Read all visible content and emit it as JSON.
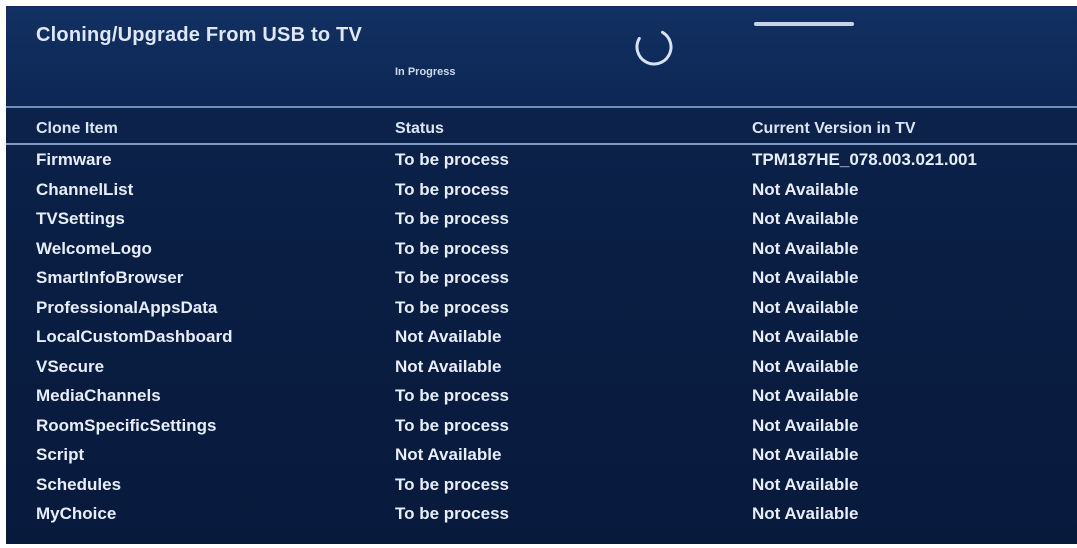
{
  "header": {
    "title": "Cloning/Upgrade From USB to TV",
    "status_text": "In Progress"
  },
  "columns": {
    "item": "Clone Item",
    "status": "Status",
    "version": "Current Version in TV"
  },
  "rows": [
    {
      "item": "Firmware",
      "status": "To be process",
      "version": "TPM187HE_078.003.021.001"
    },
    {
      "item": "ChannelList",
      "status": "To be process",
      "version": "Not Available"
    },
    {
      "item": "TVSettings",
      "status": "To be process",
      "version": "Not Available"
    },
    {
      "item": "WelcomeLogo",
      "status": "To be process",
      "version": "Not Available"
    },
    {
      "item": "SmartInfoBrowser",
      "status": "To be process",
      "version": "Not Available"
    },
    {
      "item": "ProfessionalAppsData",
      "status": "To be process",
      "version": "Not Available"
    },
    {
      "item": "LocalCustomDashboard",
      "status": "Not Available",
      "version": "Not Available"
    },
    {
      "item": "VSecure",
      "status": "Not Available",
      "version": "Not Available"
    },
    {
      "item": "MediaChannels",
      "status": "To be process",
      "version": "Not Available"
    },
    {
      "item": "RoomSpecificSettings",
      "status": "To be process",
      "version": "Not Available"
    },
    {
      "item": "Script",
      "status": "Not Available",
      "version": "Not Available"
    },
    {
      "item": "Schedules",
      "status": "To be process",
      "version": "Not Available"
    },
    {
      "item": "MyChoice",
      "status": "To be process",
      "version": "Not Available"
    }
  ],
  "icons": {
    "spinner": "loading-spinner-icon"
  },
  "colors": {
    "background": "#0a1f45",
    "header_background": "#123062",
    "text": "#e7edf8",
    "divider": "#7f9bc6"
  }
}
